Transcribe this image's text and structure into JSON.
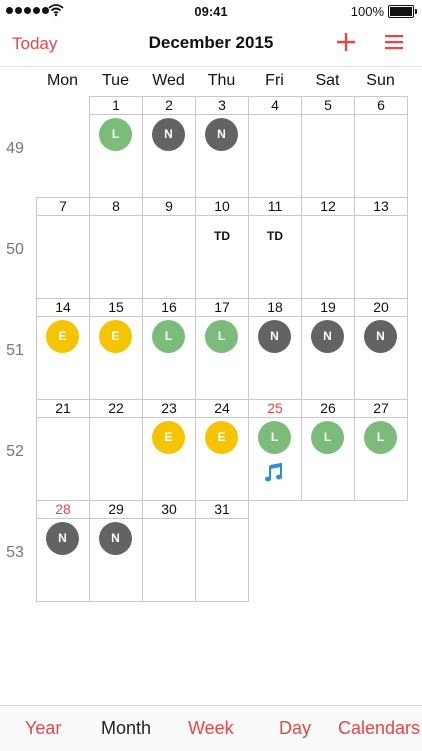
{
  "status_bar": {
    "time": "09:41",
    "battery": "100%"
  },
  "nav": {
    "today": "Today",
    "title": "December 2015"
  },
  "weekdays": [
    "Mon",
    "Tue",
    "Wed",
    "Thu",
    "Fri",
    "Sat",
    "Sun"
  ],
  "weeks": [
    {
      "number": "49",
      "days": [
        {
          "day": ""
        },
        {
          "day": "1",
          "badge": "L"
        },
        {
          "day": "2",
          "badge": "N"
        },
        {
          "day": "3",
          "badge": "N"
        },
        {
          "day": "4"
        },
        {
          "day": "5"
        },
        {
          "day": "6"
        }
      ]
    },
    {
      "number": "50",
      "days": [
        {
          "day": "7"
        },
        {
          "day": "8"
        },
        {
          "day": "9"
        },
        {
          "day": "10",
          "text": "TD"
        },
        {
          "day": "11",
          "text": "TD"
        },
        {
          "day": "12"
        },
        {
          "day": "13"
        }
      ]
    },
    {
      "number": "51",
      "days": [
        {
          "day": "14",
          "badge": "E"
        },
        {
          "day": "15",
          "badge": "E"
        },
        {
          "day": "16",
          "badge": "L"
        },
        {
          "day": "17",
          "badge": "L"
        },
        {
          "day": "18",
          "badge": "N"
        },
        {
          "day": "19",
          "badge": "N"
        },
        {
          "day": "20",
          "badge": "N"
        }
      ]
    },
    {
      "number": "52",
      "days": [
        {
          "day": "21"
        },
        {
          "day": "22"
        },
        {
          "day": "23",
          "badge": "E"
        },
        {
          "day": "24",
          "badge": "E"
        },
        {
          "day": "25",
          "badge": "L",
          "highlight": true,
          "icon": "music-note-icon"
        },
        {
          "day": "26",
          "badge": "L"
        },
        {
          "day": "27",
          "badge": "L"
        }
      ]
    },
    {
      "number": "53",
      "days": [
        {
          "day": "28",
          "badge": "N",
          "highlight": true
        },
        {
          "day": "29",
          "badge": "N"
        },
        {
          "day": "30"
        },
        {
          "day": "31"
        },
        {
          "day": ""
        },
        {
          "day": ""
        },
        {
          "day": ""
        }
      ]
    }
  ],
  "tabs": [
    {
      "label": "Year",
      "active": false
    },
    {
      "label": "Month",
      "active": true
    },
    {
      "label": "Week",
      "active": false
    },
    {
      "label": "Day",
      "active": false
    },
    {
      "label": "Calendars",
      "active": false
    }
  ],
  "colors": {
    "accent": "#e84545",
    "L": "#7cbc7a",
    "N": "#636363",
    "E": "#f5c400"
  }
}
